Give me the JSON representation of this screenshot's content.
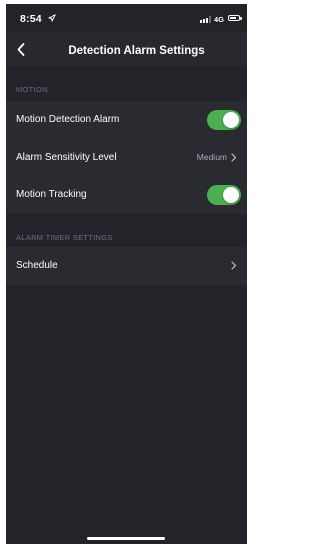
{
  "status_bar": {
    "time": "8:54",
    "network": "4G",
    "battery_level": 0.7
  },
  "nav": {
    "title": "Detection Alarm Settings"
  },
  "sections": {
    "motion": {
      "header": "MOTION",
      "motion_detection_alarm": {
        "label": "Motion Detection Alarm",
        "enabled": true
      },
      "alarm_sensitivity_level": {
        "label": "Alarm Sensitivity Level",
        "value": "Medium"
      },
      "motion_tracking": {
        "label": "Motion Tracking",
        "enabled": true
      }
    },
    "alarm_timer": {
      "header": "ALARM TIMER SETTINGS",
      "schedule": {
        "label": "Schedule"
      }
    }
  },
  "colors": {
    "background": "#232329",
    "row_background": "#2a2a31",
    "toggle_on": "#4caf50",
    "section_header_text": "#6f6f79"
  },
  "icons": {
    "back": "chevron-left-icon",
    "disclosure": "chevron-right-icon",
    "location": "location-arrow-icon",
    "signal": "cellular-signal-icon",
    "battery": "battery-icon"
  }
}
